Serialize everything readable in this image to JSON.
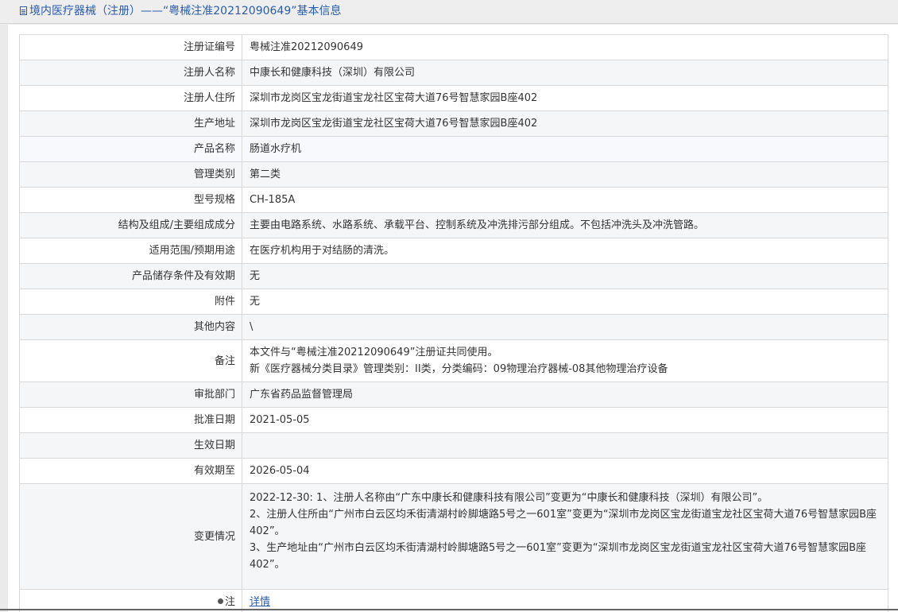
{
  "header": {
    "title": "境内医疗器械（注册）——“粤械注准20212090649”基本信息"
  },
  "rows": [
    {
      "label": "注册证编号",
      "value": "粤械注准20212090649"
    },
    {
      "label": "注册人名称",
      "value": "中康长和健康科技（深圳）有限公司"
    },
    {
      "label": "注册人住所",
      "value": "深圳市龙岗区宝龙街道宝龙社区宝荷大道76号智慧家园B座402"
    },
    {
      "label": "生产地址",
      "value": "深圳市龙岗区宝龙街道宝龙社区宝荷大道76号智慧家园B座402"
    },
    {
      "label": "产品名称",
      "value": "肠道水疗机"
    },
    {
      "label": "管理类别",
      "value": "第二类"
    },
    {
      "label": "型号规格",
      "value": "CH-185A"
    },
    {
      "label": "结构及组成/主要组成成分",
      "value": "主要由电路系统、水路系统、承载平台、控制系统及冲洗排污部分组成。不包括冲洗头及冲洗管路。"
    },
    {
      "label": "适用范围/预期用途",
      "value": "在医疗机构用于对结肠的清洗。"
    },
    {
      "label": "产品储存条件及有效期",
      "value": "无"
    },
    {
      "label": "附件",
      "value": "无"
    },
    {
      "label": "其他内容",
      "value": "\\"
    },
    {
      "label": "备注",
      "lines": [
        "本文件与“粤械注准20212090649”注册证共同使用。",
        "新《医疗器械分类目录》管理类别：II类，分类编码：09物理治疗器械-08其他物理治疗设备"
      ]
    },
    {
      "label": "审批部门",
      "value": "广东省药品监督管理局"
    },
    {
      "label": "批准日期",
      "value": "2021-05-05"
    },
    {
      "label": "生效日期",
      "value": ""
    },
    {
      "label": "有效期至",
      "value": "2026-05-04"
    },
    {
      "label": "变更情况",
      "lines": [
        "2022-12-30: 1、注册人名称由“广东中康长和健康科技有限公司”变更为“中康长和健康科技（深圳）有限公司”。",
        "2、注册人住所由“广州市白云区均禾街清湖村岭脚塘路5号之一601室”变更为“深圳市龙岗区宝龙街道宝龙社区宝荷大道76号智慧家园B座402”。",
        "3、生产地址由“广州市白云区均禾街清湖村岭脚塘路5号之一601室”变更为“深圳市龙岗区宝龙街道宝龙社区宝荷大道76号智慧家园B座402”。"
      ]
    },
    {
      "label": "注",
      "value": "详情"
    }
  ],
  "icons": {
    "title_icon": "document-icon",
    "note_icon": "dot-icon"
  },
  "colors": {
    "link": "#2a5caa",
    "border": "#d9d9d9",
    "row_alt": "#f5f6f8"
  }
}
